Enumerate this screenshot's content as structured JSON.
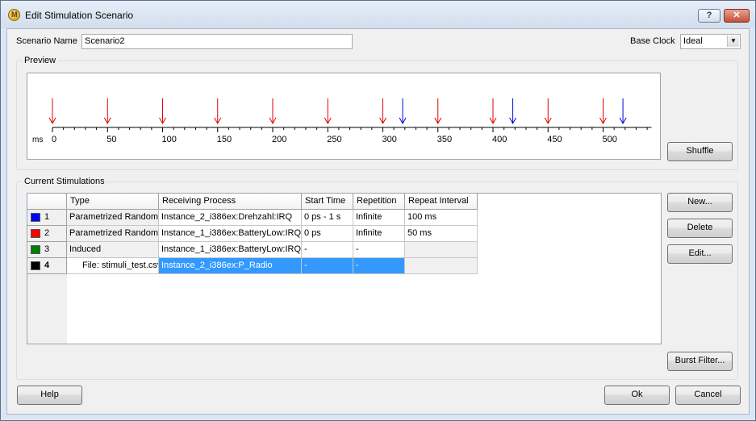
{
  "window": {
    "title": "Edit Stimulation Scenario",
    "help_btn": "?",
    "close_btn": "✕"
  },
  "scenario": {
    "label": "Scenario Name",
    "value": "Scenario2"
  },
  "base_clock": {
    "label": "Base Clock",
    "value": "Ideal"
  },
  "preview": {
    "group_title": "Preview",
    "unit": "ms",
    "ticks": [
      "0",
      "50",
      "100",
      "150",
      "200",
      "250",
      "300",
      "350",
      "400",
      "450",
      "500"
    ],
    "red_markers_ms": [
      0,
      50,
      100,
      150,
      200,
      250,
      300,
      350,
      400,
      450,
      500
    ],
    "blue_markers_ms": [
      318,
      418,
      518
    ],
    "colors": {
      "red": "#e00000",
      "blue": "#0000e0"
    }
  },
  "shuffle_label": "Shuffle",
  "stimulations": {
    "group_title": "Current Stimulations",
    "columns": [
      "Type",
      "Receiving Process",
      "Start Time",
      "Repetition",
      "Repeat Interval"
    ],
    "rows": [
      {
        "num": "1",
        "color": "#0000ff",
        "cells": [
          "Parametrized Random",
          "Instance_2_i386ex:Drehzahl:IRQ",
          "0 ps - 1 s",
          "Infinite",
          "100 ms"
        ]
      },
      {
        "num": "2",
        "color": "#ff0000",
        "cells": [
          "Parametrized Random",
          "Instance_1_i386ex:BatteryLow:IRQ",
          "0 ps",
          "Infinite",
          "50 ms"
        ]
      },
      {
        "num": "3",
        "color": "#008000",
        "cells": [
          "Induced",
          "Instance_1_i386ex:BatteryLow:IRQ",
          "-",
          "-",
          ""
        ]
      },
      {
        "num": "4",
        "color": "#000000",
        "cells": [
          "File: stimuli_test.csv",
          "Instance_2_i386ex:P_Radio",
          "-",
          "-",
          ""
        ]
      }
    ]
  },
  "buttons": {
    "new": "New...",
    "delete": "Delete",
    "edit": "Edit...",
    "burst": "Burst Filter...",
    "help": "Help",
    "ok": "Ok",
    "cancel": "Cancel"
  }
}
